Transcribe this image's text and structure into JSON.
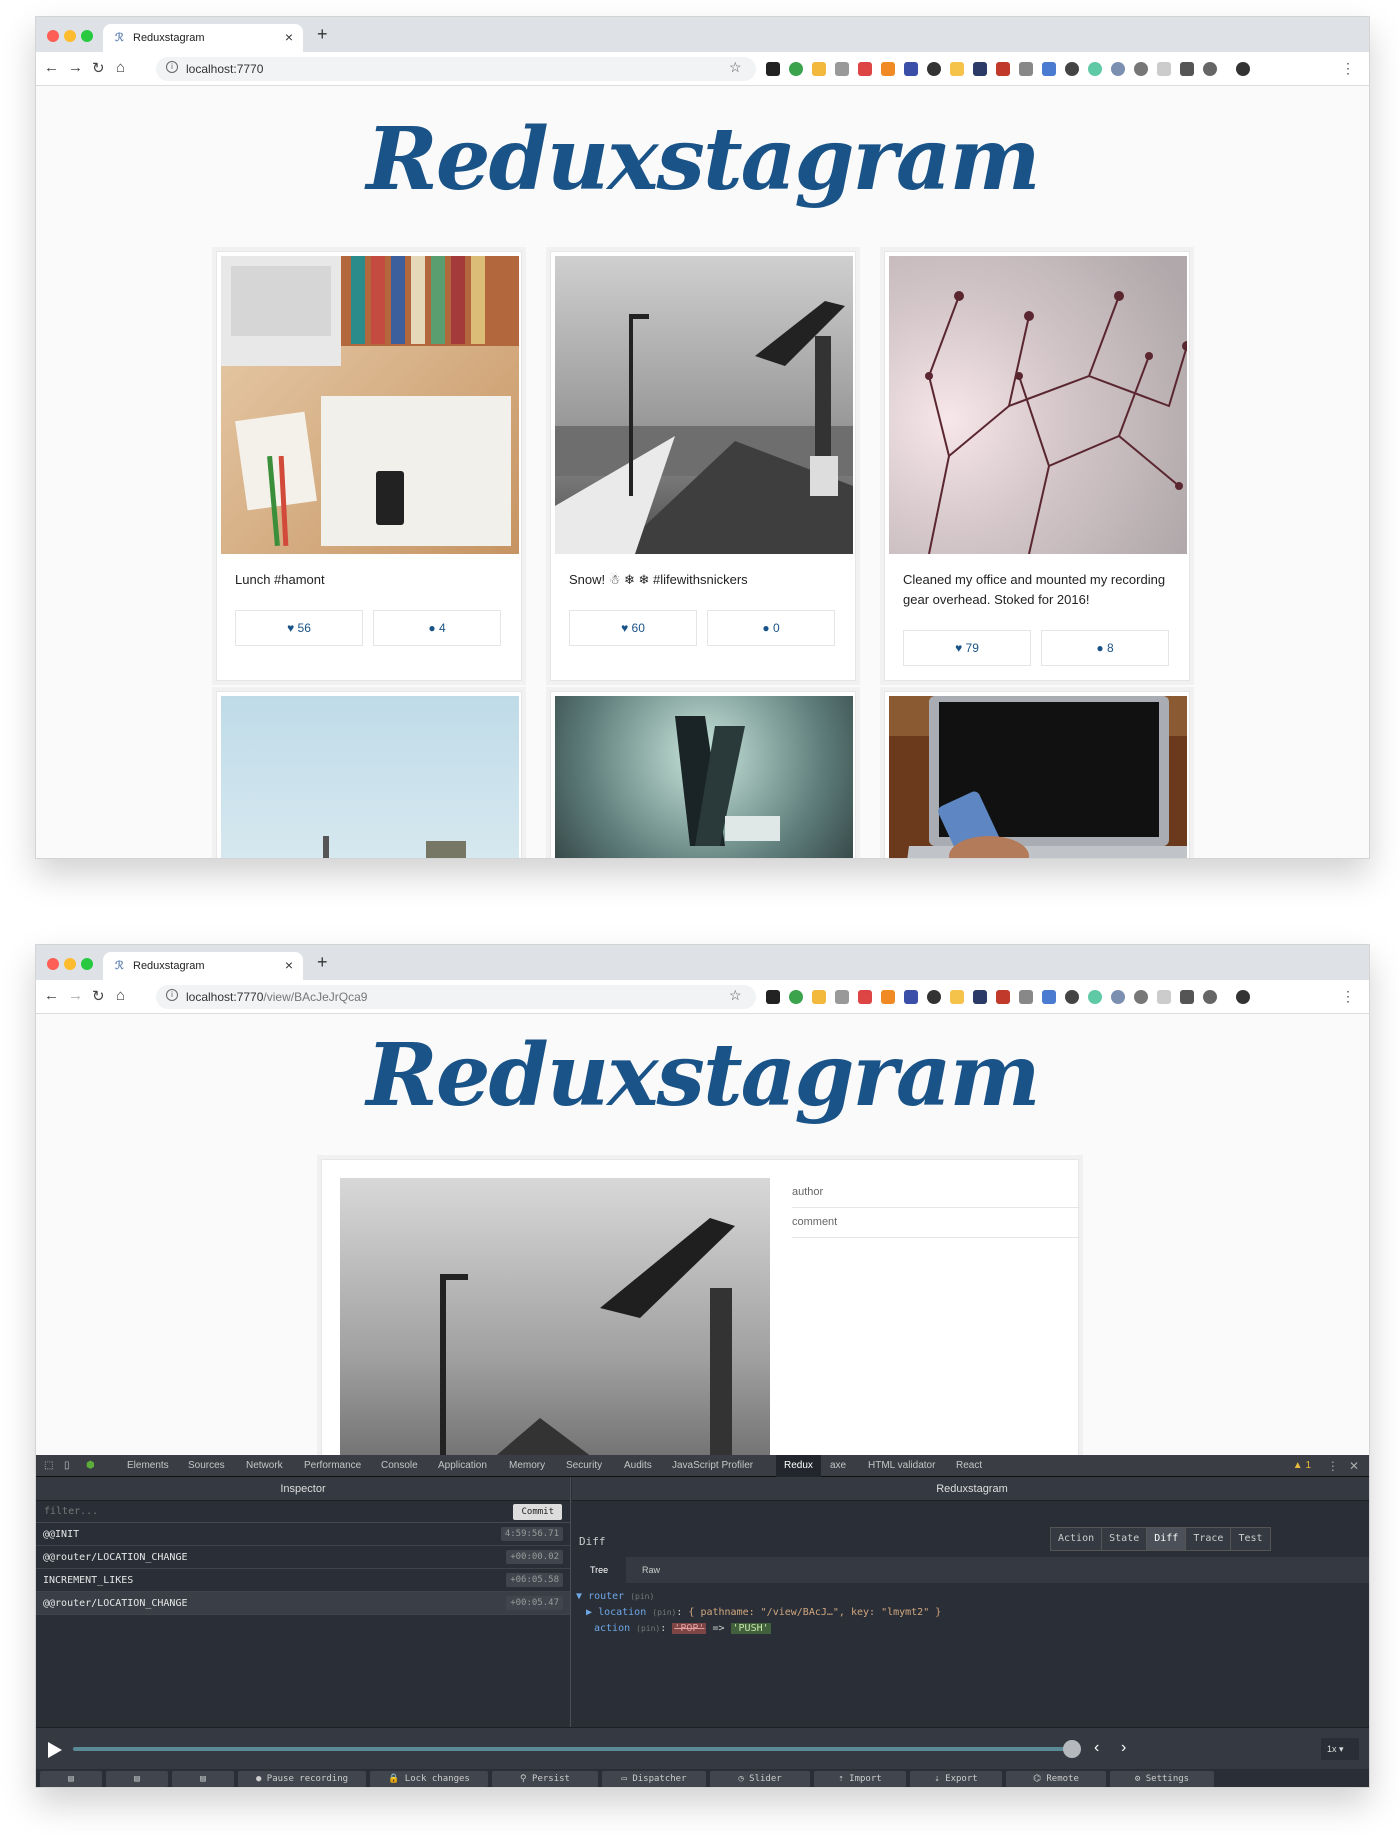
{
  "window1": {
    "tab_title": "Reduxstagram",
    "url_host": "localhost:7770",
    "url_path": "",
    "logo": "Reduxstagram",
    "posts": [
      {
        "caption": "Lunch #hamont",
        "likes": "56",
        "comments": "4"
      },
      {
        "caption": "Snow! ☃ ❄ ❄ #lifewithsnickers",
        "likes": "60",
        "comments": "0"
      },
      {
        "caption": "Cleaned my office and mounted my recording gear overhead. Stoked for 2016!",
        "likes": "79",
        "comments": "8"
      }
    ]
  },
  "window2": {
    "tab_title": "Reduxstagram",
    "url_host": "localhost:7770",
    "url_path": "/view/BAcJeJrQca9",
    "logo": "Reduxstagram",
    "comment_fields": {
      "author": "author",
      "comment": "comment"
    }
  },
  "devtools": {
    "tabs": [
      "Elements",
      "Sources",
      "Network",
      "Performance",
      "Console",
      "Application",
      "Memory",
      "Security",
      "Audits",
      "JavaScript Profiler",
      "Redux",
      "axe",
      "HTML validator",
      "React"
    ],
    "active_tab": "Redux",
    "warning_count": "1",
    "inspector_title": "Inspector",
    "store_title": "Reduxstagram",
    "filter_placeholder": "filter...",
    "commit_label": "Commit",
    "actions": [
      {
        "name": "@@INIT",
        "time": "4:59:56.71"
      },
      {
        "name": "@@router/LOCATION_CHANGE",
        "time": "+00:00.02"
      },
      {
        "name": "INCREMENT_LIKES",
        "time": "+06:05.58"
      },
      {
        "name": "@@router/LOCATION_CHANGE",
        "time": "+00:05.47"
      }
    ],
    "monitor_label": "Diff",
    "monitor_tabs": [
      "Action",
      "State",
      "Diff",
      "Trace",
      "Test"
    ],
    "active_monitor_tab": "Diff",
    "view_tabs": [
      "Tree",
      "Raw"
    ],
    "tree": {
      "router_key": "router",
      "pin": "(pin)",
      "location_key": "location",
      "location_value": "{ pathname: \"/view/BAcJ…\", key: \"lmymt2\" }",
      "action_key": "action",
      "old_value": "'POP'",
      "arrow": "=>",
      "new_value": "'PUSH'"
    },
    "speed": "1x",
    "bottom_buttons": [
      "Pause recording",
      "Lock changes",
      "Persist",
      "Dispatcher",
      "Slider",
      "Import",
      "Export",
      "Remote",
      "Settings"
    ]
  }
}
